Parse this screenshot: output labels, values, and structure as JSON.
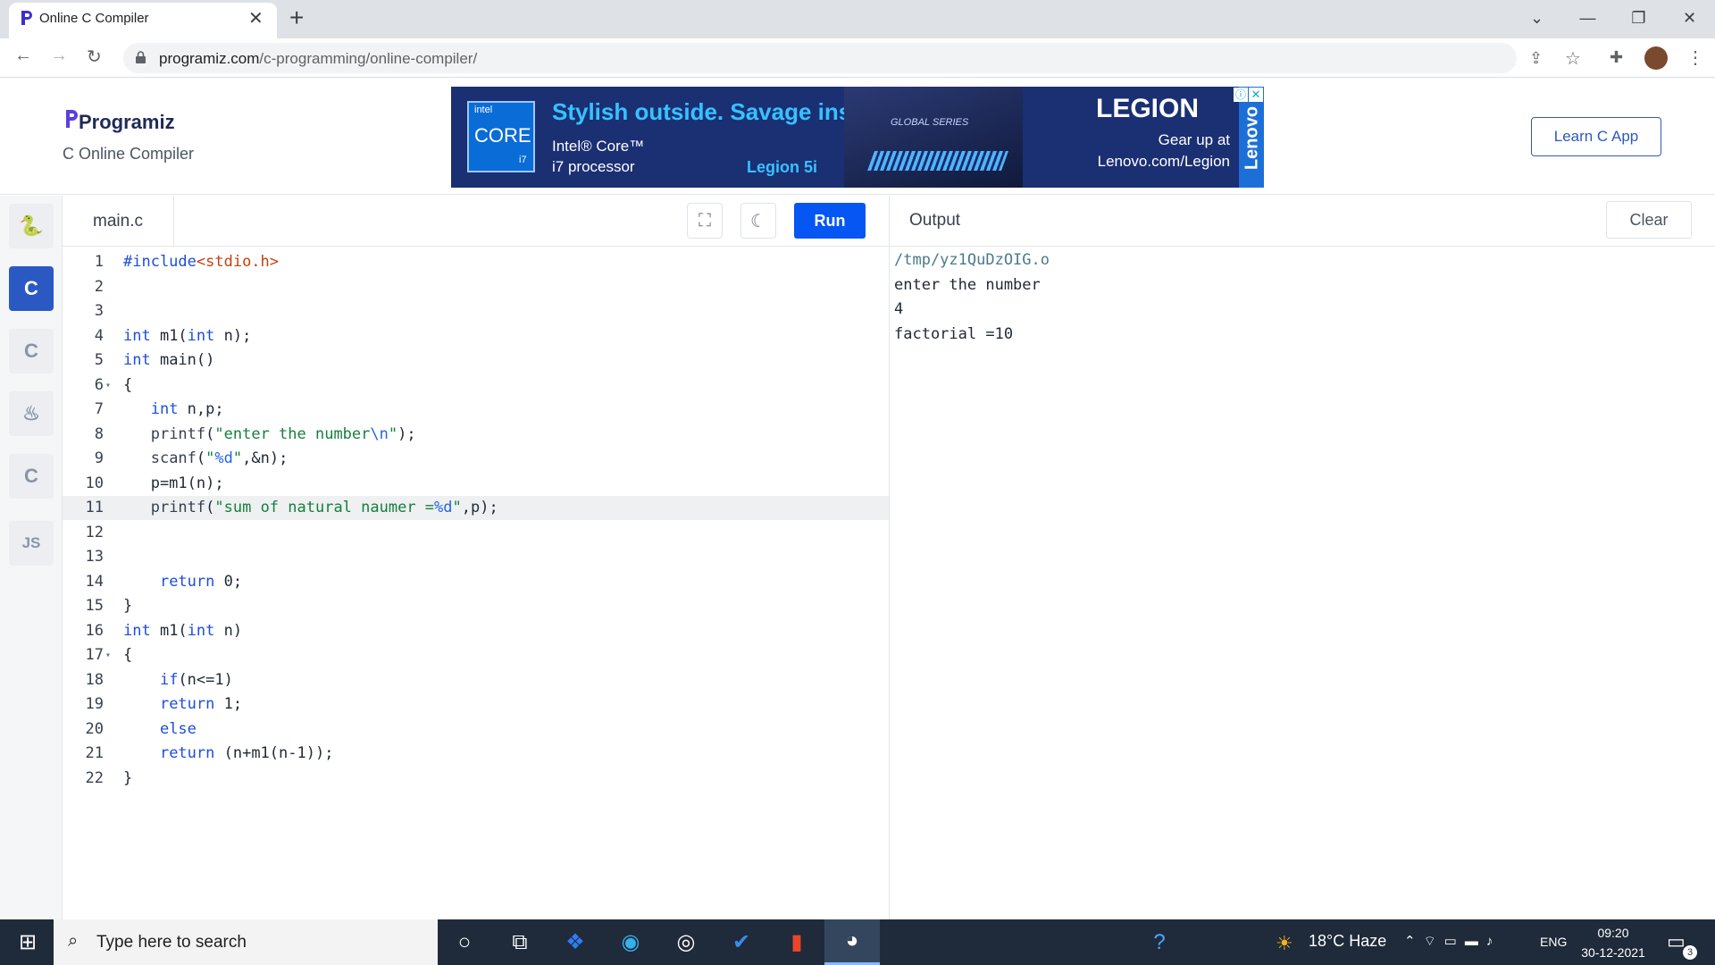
{
  "browser": {
    "tab_title": "Online C Compiler",
    "new_tab": "+",
    "url_host": "programiz.com",
    "url_path": "/c-programming/online-compiler/"
  },
  "site": {
    "logo": "Programiz",
    "subtitle": "C Online Compiler",
    "learn_button": "Learn C App"
  },
  "ad": {
    "headline": "Stylish outside. Savage inside.",
    "chip_brand": "intel",
    "chip_name": "CORE",
    "chip_tier": "i7",
    "cpu_line1": "Intel® Core™",
    "cpu_line2": "i7 processor",
    "model": "Legion 5i",
    "badge": "GLOBAL SERIES",
    "brand": "LEGION",
    "cta_line1": "Gear up at",
    "cta_line2": "Lenovo.com/Legion",
    "vendor": "Lenovo"
  },
  "rail": {
    "js_label": "JS"
  },
  "editor": {
    "filename": "main.c",
    "run_label": "Run",
    "lines": [
      "#include<stdio.h>",
      "",
      "",
      "int m1(int n);",
      "int main()",
      "{",
      "   int n,p;",
      "   printf(\"enter the number\\n\");",
      "   scanf(\"%d\",&n);",
      "   p=m1(n);",
      "   printf(\"sum of natural naumer =%d\",p);",
      "",
      "",
      "    return 0;",
      "}",
      "int m1(int n)",
      "{",
      "    if(n<=1)",
      "    return 1;",
      "    else",
      "    return (n+m1(n-1));",
      "}"
    ],
    "highlight_line": 11
  },
  "output": {
    "title": "Output",
    "clear_label": "Clear",
    "lines": [
      "/tmp/yz1QuDzOIG.o",
      "enter the number",
      "4",
      "factorial =10"
    ]
  },
  "taskbar": {
    "search_placeholder": "Type here to search",
    "weather": "18°C  Haze",
    "lang": "ENG",
    "time": "09:20",
    "date": "30-12-2021",
    "notif_count": "3"
  }
}
